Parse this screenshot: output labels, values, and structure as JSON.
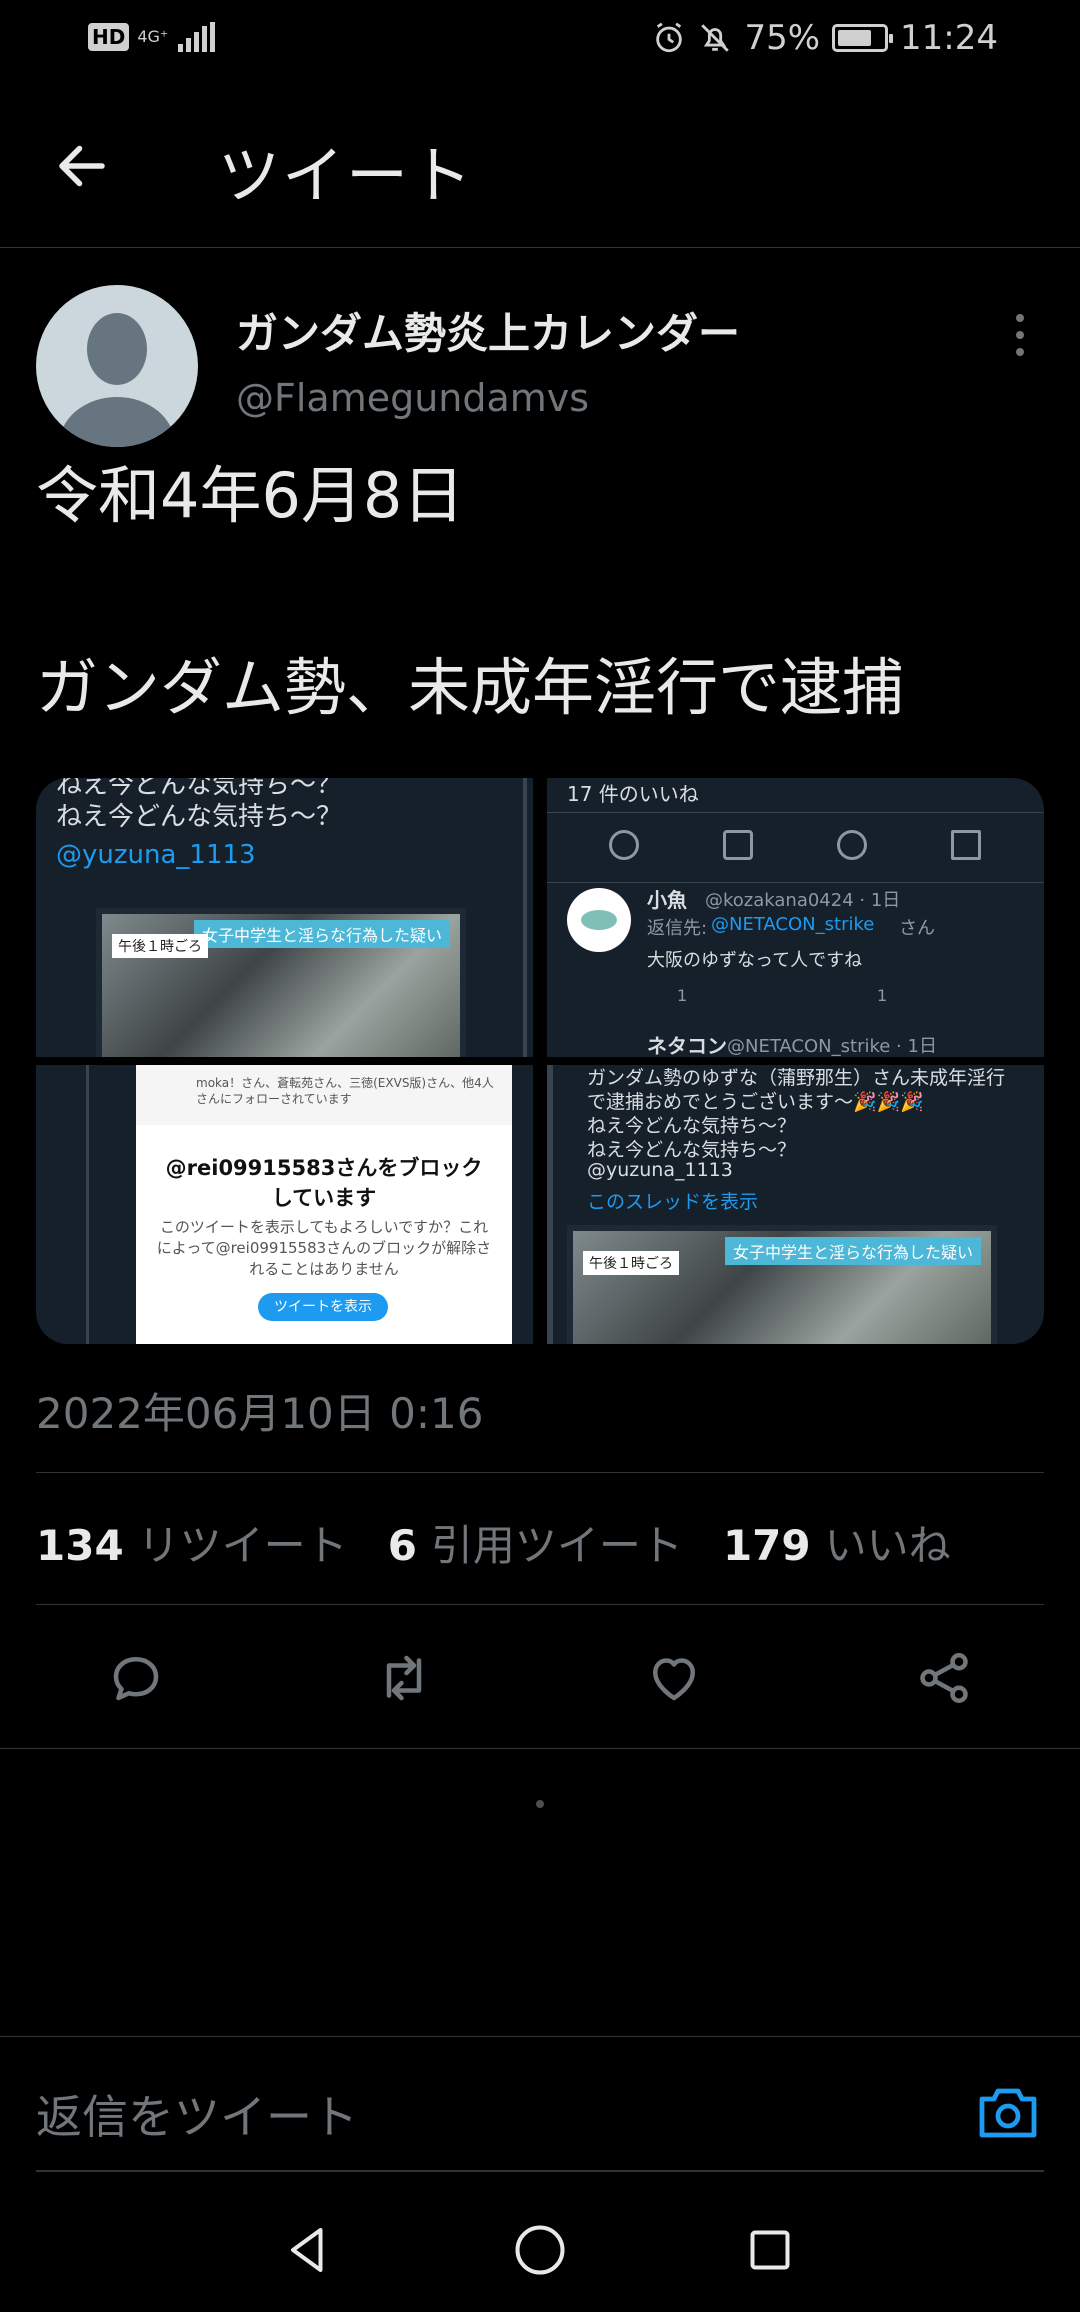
{
  "status_bar": {
    "hd": "HD",
    "network": "4G⁺",
    "battery": "75%",
    "battery_fraction": 0.75,
    "time": "11:24"
  },
  "header": {
    "title": "ツイート"
  },
  "tweet": {
    "display_name": "ガンダム勢炎上カレンダー",
    "handle": "@Flamegundamvs",
    "text_line1": "令和4年6月8日",
    "text_line2": "ガンダム勢、未成年淫行で逮捕",
    "timestamp": "2022年06月10日 0:16"
  },
  "media": {
    "cell1": {
      "line_top": "ねえ今どんな気持ち～？",
      "line1": "ねえ今どんな気持ち～？",
      "mention": "@yuzuna_1113",
      "photo_banner": "女子中学生と淫らな行為した疑い",
      "photo_label": "午後１時ごろ"
    },
    "cell2": {
      "likes_line": "17 件のいいね",
      "reply_name": "小魚",
      "reply_handle": "@kozakana0424 · 1日",
      "reply_to_prefix": "返信先:",
      "reply_to_user": "@NETACON_strike",
      "reply_to_suffix": "さん",
      "reply_text": "大阪のゆずなって人ですね",
      "reply_count": "1",
      "like_count": "1",
      "next_name": "ネタコン",
      "next_handle": "@NETACON_strike · 1日"
    },
    "cell3": {
      "follow_note": "moka！さん、蒼転苑さん、三徳(EXVS版)さん、他4人さんにフォローされています",
      "block_title": "@rei09915583さんをブロックしています",
      "block_body": "このツイートを表示してもよろしいですか？これによって@rei09915583さんのブロックが解除されることはありません",
      "block_button": "ツイートを表示"
    },
    "cell4": {
      "line1": "ガンダム勢のゆずな（蒲野那生）さん未成年淫行",
      "line2": "で逮捕おめでとうございます～🎉🎉🎉",
      "line3": "ねえ今どんな気持ち～？",
      "line4": "ねえ今どんな気持ち～？",
      "line5": "@yuzuna_1113",
      "thread_link": "このスレッドを表示",
      "photo_banner": "女子中学生と淫らな行為した疑い",
      "photo_label": "午後１時ごろ"
    }
  },
  "stats": {
    "retweets_count": "134",
    "retweets_label": "リツイート",
    "quotes_count": "6",
    "quotes_label": "引用ツイート",
    "likes_count": "179",
    "likes_label": "いいね"
  },
  "actions": {
    "reply_icon": "reply-icon",
    "retweet_icon": "retweet-icon",
    "like_icon": "heart-icon",
    "share_icon": "share-icon"
  },
  "reply_bar": {
    "placeholder": "返信をツイート"
  },
  "colors": {
    "background": "#000000",
    "accent": "#1d9bf0",
    "text_primary": "#e7e9ea",
    "text_secondary": "#71767b",
    "divider": "#2f3336"
  }
}
